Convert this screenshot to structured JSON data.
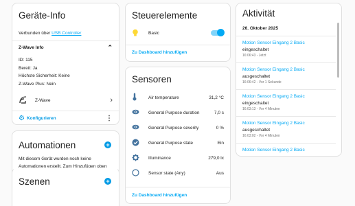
{
  "device_info": {
    "title": "Geräte-Info",
    "connected_prefix": "Verbunden über",
    "connected_link": "USB Controller",
    "zwave_section_title": "Z-Wave Info",
    "lines": [
      "ID: 115",
      "Bereit: Ja",
      "Höchste Sicherheit: Keine",
      "Z-Wave Plus: Nein"
    ],
    "zwave_row_label": "Z-Wave",
    "configure_label": "Konfigurieren"
  },
  "automations": {
    "title": "Automationen",
    "text": "Mit diesem Gerät wurden noch keine Automationen erstellt. Zum Hinzufügen oben den + Knopf drücken."
  },
  "scenes": {
    "title": "Szenen"
  },
  "controls": {
    "title": "Steuerelemente",
    "entity_label": "Basic",
    "toggle_on": true,
    "add_to_dashboard": "Zu Dashboard hinzufügen"
  },
  "sensors": {
    "title": "Sensoren",
    "items": [
      {
        "label": "Air temperature",
        "value": "31,2 °C",
        "icon": "thermometer-icon"
      },
      {
        "label": "General Purpose duration",
        "value": "7,0 s",
        "icon": "eye-icon"
      },
      {
        "label": "General Purpose severity",
        "value": "0 %",
        "icon": "eye-icon"
      },
      {
        "label": "General Purpose state",
        "value": "Ein",
        "icon": "check-circle-icon"
      },
      {
        "label": "Illuminance",
        "value": "279,0 lx",
        "icon": "brightness-icon"
      },
      {
        "label": "Sensor state (Any)",
        "value": "Aus",
        "icon": "circle-outline-icon"
      }
    ],
    "add_to_dashboard": "Zu Dashboard hinzufügen"
  },
  "activity": {
    "title": "Aktivität",
    "date": "26. Oktober 2025",
    "entries": [
      {
        "name": "Motion Sensor Eingang 2 Basic",
        "state": "eingeschaltet",
        "time": "16:06:43 - Jetzt"
      },
      {
        "name": "Motion Sensor Eingang 2 Basic",
        "state": "ausgeschaltet",
        "time": "16:06:42 - Vor 1 Sekunde"
      },
      {
        "name": "Motion Sensor Eingang 2 Basic",
        "state": "eingeschaltet",
        "time": "16:03:13 - Vor 4 Minuten"
      },
      {
        "name": "Motion Sensor Eingang 2 Basic",
        "state": "ausgeschaltet",
        "time": "16:03:02 - Vor 4 Minuten"
      },
      {
        "name": "Motion Sensor Eingang 2 Basic",
        "state": "",
        "time": ""
      }
    ]
  },
  "colors": {
    "accent": "#039be5",
    "toggle": "#03a9f4",
    "bulb": "#fdd835"
  }
}
